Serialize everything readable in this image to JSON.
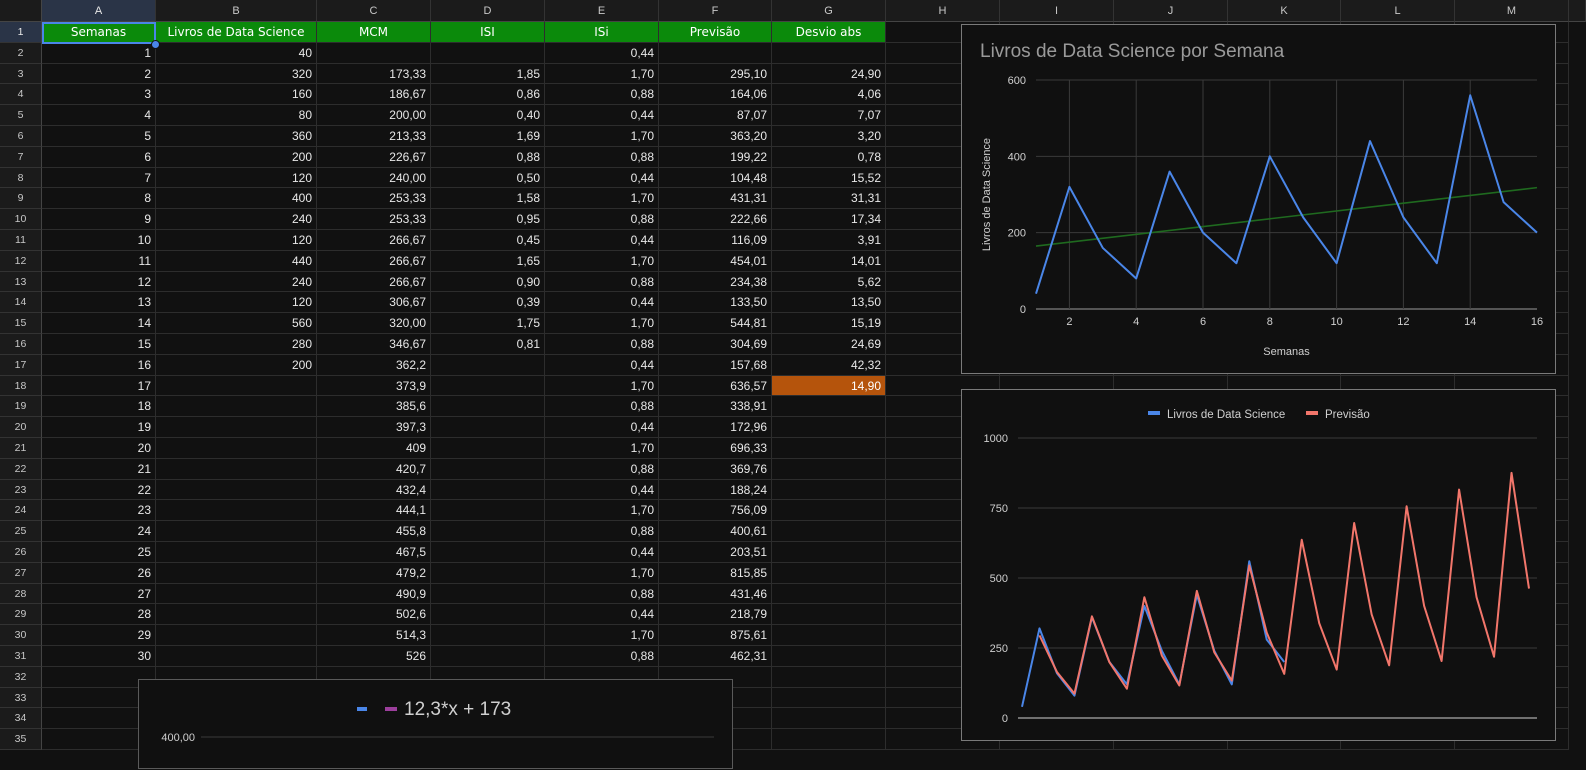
{
  "columns": [
    "A",
    "B",
    "C",
    "D",
    "E",
    "F",
    "G",
    "H",
    "I",
    "J",
    "K",
    "L",
    "M"
  ],
  "row_numbers": [
    1,
    2,
    3,
    4,
    5,
    6,
    7,
    8,
    9,
    10,
    11,
    12,
    13,
    14,
    15,
    16,
    17,
    18,
    19,
    20,
    21,
    22,
    23,
    24,
    25,
    26,
    27,
    28,
    29,
    30,
    31,
    32,
    33,
    34,
    35
  ],
  "headers": [
    "Semanas",
    "Livros de Data Science",
    "MCM",
    "ISI",
    "ISi",
    "Previsão",
    "Desvio abs"
  ],
  "rows": [
    [
      "1",
      "40",
      "",
      "",
      "0,44",
      "",
      ""
    ],
    [
      "2",
      "320",
      "173,33",
      "1,85",
      "1,70",
      "295,10",
      "24,90"
    ],
    [
      "3",
      "160",
      "186,67",
      "0,86",
      "0,88",
      "164,06",
      "4,06"
    ],
    [
      "4",
      "80",
      "200,00",
      "0,40",
      "0,44",
      "87,07",
      "7,07"
    ],
    [
      "5",
      "360",
      "213,33",
      "1,69",
      "1,70",
      "363,20",
      "3,20"
    ],
    [
      "6",
      "200",
      "226,67",
      "0,88",
      "0,88",
      "199,22",
      "0,78"
    ],
    [
      "7",
      "120",
      "240,00",
      "0,50",
      "0,44",
      "104,48",
      "15,52"
    ],
    [
      "8",
      "400",
      "253,33",
      "1,58",
      "1,70",
      "431,31",
      "31,31"
    ],
    [
      "9",
      "240",
      "253,33",
      "0,95",
      "0,88",
      "222,66",
      "17,34"
    ],
    [
      "10",
      "120",
      "266,67",
      "0,45",
      "0,44",
      "116,09",
      "3,91"
    ],
    [
      "11",
      "440",
      "266,67",
      "1,65",
      "1,70",
      "454,01",
      "14,01"
    ],
    [
      "12",
      "240",
      "266,67",
      "0,90",
      "0,88",
      "234,38",
      "5,62"
    ],
    [
      "13",
      "120",
      "306,67",
      "0,39",
      "0,44",
      "133,50",
      "13,50"
    ],
    [
      "14",
      "560",
      "320,00",
      "1,75",
      "1,70",
      "544,81",
      "15,19"
    ],
    [
      "15",
      "280",
      "346,67",
      "0,81",
      "0,88",
      "304,69",
      "24,69"
    ],
    [
      "16",
      "200",
      "362,2",
      "",
      "0,44",
      "157,68",
      "42,32"
    ],
    [
      "17",
      "",
      "373,9",
      "",
      "1,70",
      "636,57",
      "14,90"
    ],
    [
      "18",
      "",
      "385,6",
      "",
      "0,88",
      "338,91",
      ""
    ],
    [
      "19",
      "",
      "397,3",
      "",
      "0,44",
      "172,96",
      ""
    ],
    [
      "20",
      "",
      "409",
      "",
      "1,70",
      "696,33",
      ""
    ],
    [
      "21",
      "",
      "420,7",
      "",
      "0,88",
      "369,76",
      ""
    ],
    [
      "22",
      "",
      "432,4",
      "",
      "0,44",
      "188,24",
      ""
    ],
    [
      "23",
      "",
      "444,1",
      "",
      "1,70",
      "756,09",
      ""
    ],
    [
      "24",
      "",
      "455,8",
      "",
      "0,88",
      "400,61",
      ""
    ],
    [
      "25",
      "",
      "467,5",
      "",
      "0,44",
      "203,51",
      ""
    ],
    [
      "26",
      "",
      "479,2",
      "",
      "1,70",
      "815,85",
      ""
    ],
    [
      "27",
      "",
      "490,9",
      "",
      "0,88",
      "431,46",
      ""
    ],
    [
      "28",
      "",
      "502,6",
      "",
      "0,44",
      "218,79",
      ""
    ],
    [
      "29",
      "",
      "514,3",
      "",
      "1,70",
      "875,61",
      ""
    ],
    [
      "30",
      "",
      "526",
      "",
      "0,88",
      "462,31",
      ""
    ]
  ],
  "colors": {
    "header_green": "#0b8a0b",
    "highlight_orange": "#b5540c",
    "series_blue": "#4a86e8",
    "series_red": "#f2766b",
    "trend_green": "#1f6a1f",
    "trend_purple": "#9c3f9c"
  },
  "chart_data": [
    {
      "type": "line",
      "title": "Livros de Data Science por Semana",
      "xlabel": "Semanas",
      "ylabel": "Livros de Data Science",
      "xlim": [
        1,
        16
      ],
      "ylim": [
        0,
        600
      ],
      "x_ticks": [
        "2",
        "4",
        "6",
        "8",
        "10",
        "12",
        "14",
        "16"
      ],
      "y_ticks": [
        "0",
        "200",
        "400",
        "600"
      ],
      "x": [
        1,
        2,
        3,
        4,
        5,
        6,
        7,
        8,
        9,
        10,
        11,
        12,
        13,
        14,
        15,
        16
      ],
      "series": [
        {
          "values": [
            40,
            320,
            160,
            80,
            360,
            200,
            120,
            400,
            240,
            120,
            440,
            240,
            120,
            560,
            280,
            200
          ]
        }
      ],
      "trendline": {
        "values": [
          165,
          318
        ]
      }
    },
    {
      "type": "line",
      "legend": "top",
      "ylim": [
        0,
        1000
      ],
      "y_ticks": [
        "0",
        "250",
        "500",
        "750",
        "1000"
      ],
      "x": [
        1,
        2,
        3,
        4,
        5,
        6,
        7,
        8,
        9,
        10,
        11,
        12,
        13,
        14,
        15,
        16,
        17,
        18,
        19,
        20,
        21,
        22,
        23,
        24,
        25,
        26,
        27,
        28,
        29,
        30
      ],
      "series": [
        {
          "name": "Livros de Data Science",
          "values": [
            40,
            320,
            160,
            80,
            360,
            200,
            120,
            400,
            240,
            120,
            440,
            240,
            120,
            560,
            280,
            200
          ]
        },
        {
          "name": "Previsão",
          "values": [
            null,
            295.1,
            164.06,
            87.07,
            363.2,
            199.22,
            104.48,
            431.31,
            222.66,
            116.09,
            454.01,
            234.38,
            133.5,
            544.81,
            304.69,
            157.68,
            636.57,
            338.91,
            172.96,
            696.33,
            369.76,
            188.24,
            756.09,
            400.61,
            203.51,
            815.85,
            431.46,
            218.79,
            875.61,
            462.31
          ]
        }
      ]
    },
    {
      "type": "line",
      "legend_label": "12,3*x + 173",
      "y_ticks": [
        "400,00"
      ]
    }
  ]
}
